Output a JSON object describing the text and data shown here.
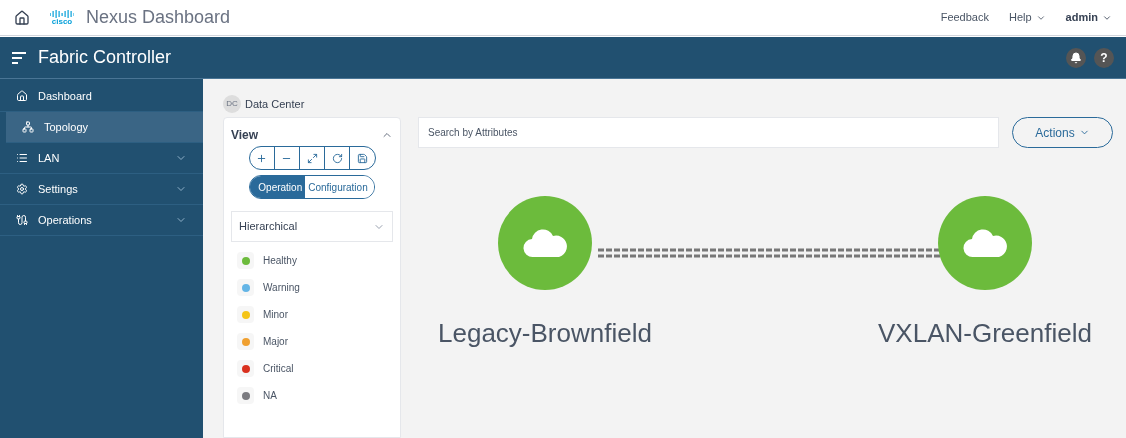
{
  "top_bar": {
    "logo": "cisco",
    "title": "Nexus Dashboard",
    "links": [
      {
        "label": "Feedback",
        "dropdown": false
      },
      {
        "label": "Help",
        "dropdown": true
      },
      {
        "label": "admin",
        "dropdown": true
      }
    ]
  },
  "header": {
    "title": "Fabric Controller",
    "help": "?"
  },
  "sidebar": {
    "items": [
      {
        "label": "Dashboard",
        "selected": false,
        "expandable": false
      },
      {
        "label": "Topology",
        "selected": true,
        "expandable": false
      },
      {
        "label": "LAN",
        "selected": false,
        "expandable": true
      },
      {
        "label": "Settings",
        "selected": false,
        "expandable": true
      },
      {
        "label": "Operations",
        "selected": false,
        "expandable": true
      }
    ]
  },
  "breadcrumb": {
    "avatar": "DC",
    "label": "Data Center"
  },
  "view_panel": {
    "title": "View",
    "mode_toggle": [
      {
        "label": "Operation",
        "selected": true
      },
      {
        "label": "Configuration",
        "selected": false
      }
    ],
    "layout_select": {
      "value": "Hierarchical"
    },
    "legend": [
      {
        "label": "Healthy",
        "color": "#6cbb3c"
      },
      {
        "label": "Warning",
        "color": "#64b5e6"
      },
      {
        "label": "Minor",
        "color": "#f5c518"
      },
      {
        "label": "Major",
        "color": "#f0a030"
      },
      {
        "label": "Critical",
        "color": "#d9301e"
      },
      {
        "label": "NA",
        "color": "#7a7a7f"
      }
    ]
  },
  "search": {
    "placeholder": "Search by Attributes"
  },
  "actions_button": {
    "label": "Actions"
  },
  "topology": {
    "nodes": [
      {
        "label": "Legacy-Brownfield",
        "color": "#6cbb3c"
      },
      {
        "label": "VXLAN-Greenfield",
        "color": "#6cbb3c"
      }
    ]
  }
}
